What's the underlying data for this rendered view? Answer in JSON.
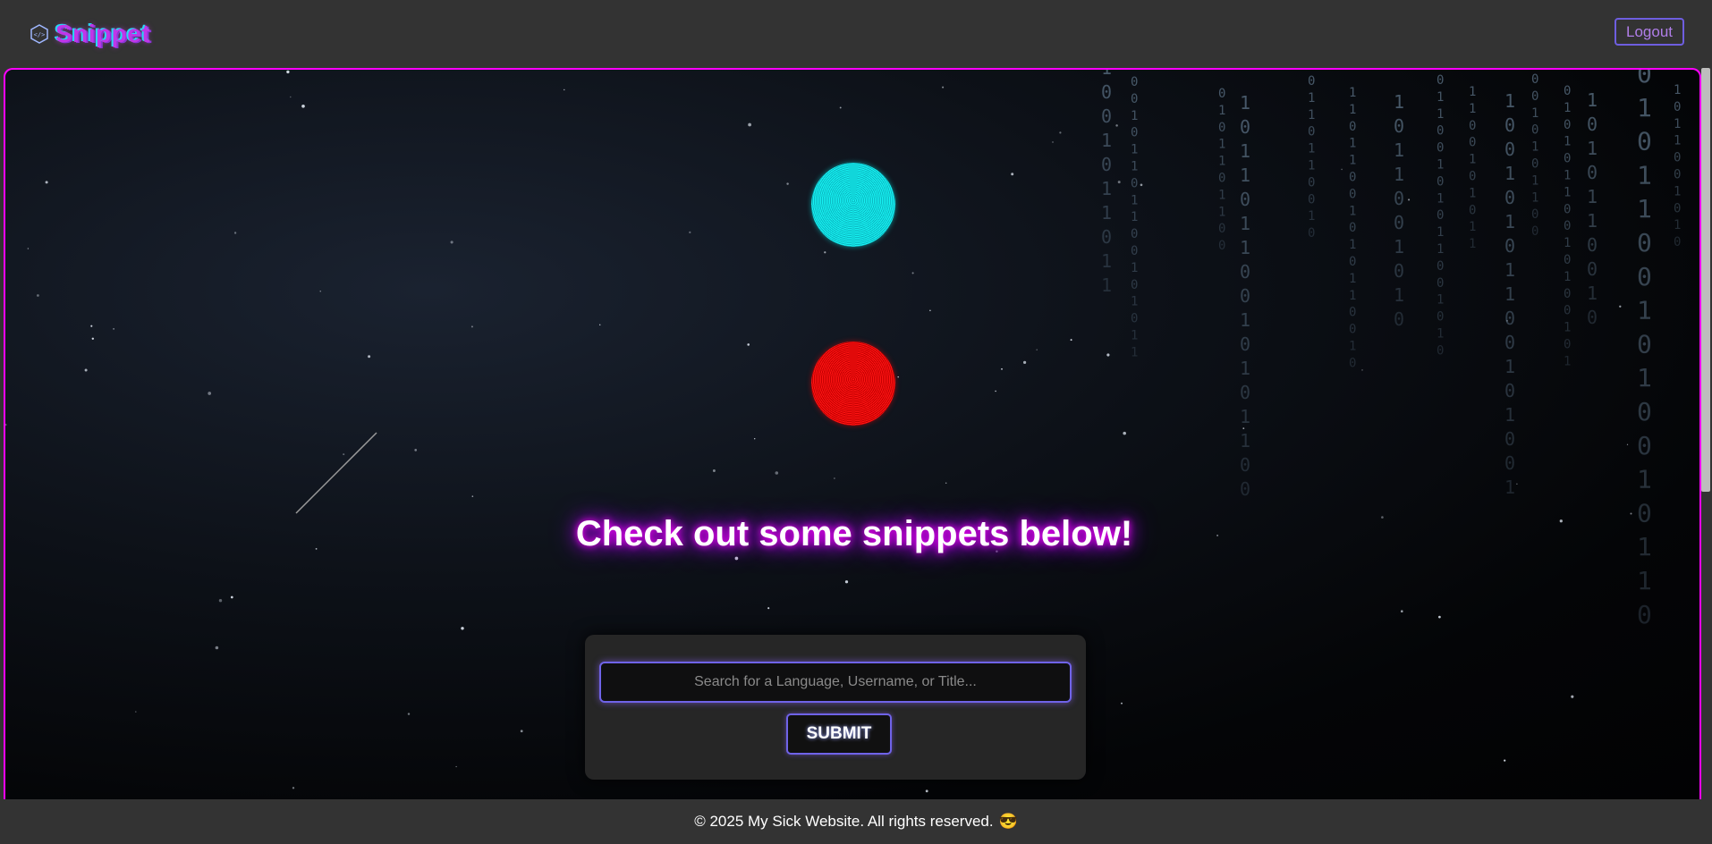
{
  "header": {
    "brand_name": "Snippet",
    "brand_icon": "code-cube-icon",
    "logout_label": "Logout"
  },
  "hero": {
    "headline": "Check out some snippets below!",
    "orbs": [
      {
        "name": "cyan-orb",
        "color": "#17f3f3"
      },
      {
        "name": "red-orb",
        "color": "#ff1414"
      }
    ],
    "matrix_rain": [
      "1",
      "0",
      "0",
      "1",
      "0",
      "1",
      "1",
      "0",
      "1",
      "1",
      "0",
      "0",
      "1",
      "0",
      "1",
      "0",
      "1",
      "1",
      "0",
      "0",
      "1",
      "0"
    ]
  },
  "search": {
    "placeholder": "Search for a Language, Username, or Title...",
    "value": "",
    "submit_label": "SUBMIT"
  },
  "footer": {
    "text": "© 2025 My Sick Website. All rights reserved.",
    "emoji": "😎"
  },
  "colors": {
    "accent_magenta": "#ff00ff",
    "accent_purple": "#6f63e8",
    "background": "#333333"
  }
}
